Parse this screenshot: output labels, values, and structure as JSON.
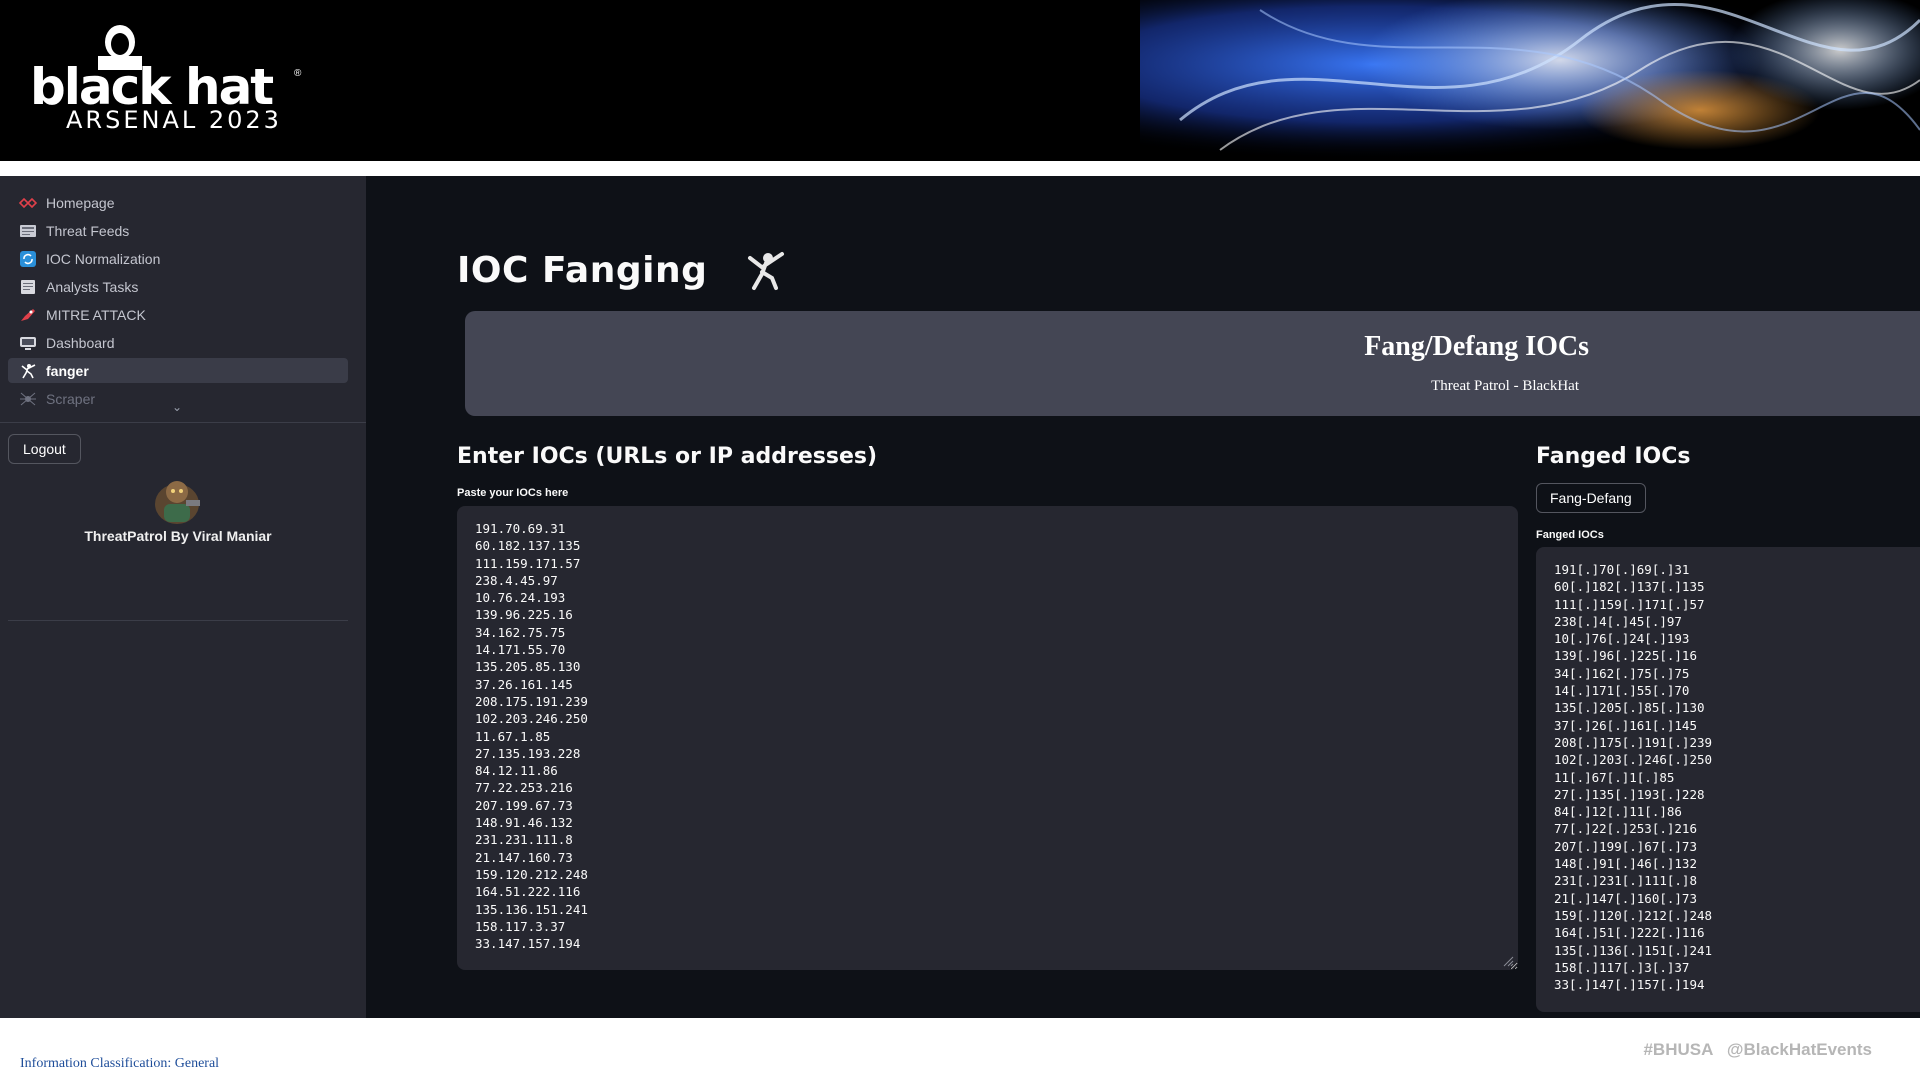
{
  "banner": {
    "logo_word": "black hat",
    "logo_reg": "®",
    "logo_event": "ARSENAL 2023"
  },
  "sidebar": {
    "items": [
      {
        "label": "Homepage",
        "icon": "radar-icon"
      },
      {
        "label": "Threat Feeds",
        "icon": "newspaper-icon"
      },
      {
        "label": "IOC Normalization",
        "icon": "refresh-icon"
      },
      {
        "label": "Analysts Tasks",
        "icon": "notepad-icon"
      },
      {
        "label": "MITRE ATTACK",
        "icon": "rocket-icon"
      },
      {
        "label": "Dashboard",
        "icon": "monitor-icon"
      },
      {
        "label": "fanger",
        "icon": "fencer-icon"
      },
      {
        "label": "Scraper",
        "icon": "spider-icon"
      }
    ],
    "active_item": "fanger",
    "logout_label": "Logout",
    "credit": "ThreatPatrol By Viral Maniar"
  },
  "main": {
    "title": "IOC Fanging",
    "hero_title": "Fang/Defang IOCs",
    "hero_subtitle": "Threat Patrol - BlackHat",
    "left_heading": "Enter IOCs (URLs or IP addresses)",
    "input_label": "Paste your IOCs here",
    "input_value": "191.70.69.31\n60.182.137.135\n111.159.171.57\n238.4.45.97\n10.76.24.193\n139.96.225.16\n34.162.75.75\n14.171.55.70\n135.205.85.130\n37.26.161.145\n208.175.191.239\n102.203.246.250\n11.67.1.85\n27.135.193.228\n84.12.11.86\n77.22.253.216\n207.199.67.73\n148.91.46.132\n231.231.111.8\n21.147.160.73\n159.120.212.248\n164.51.222.116\n135.136.151.241\n158.117.3.37\n33.147.157.194",
    "right_heading": "Fanged IOCs",
    "fang_button": "Fang-Defang",
    "output_label": "Fanged IOCs",
    "output_lines": [
      "191[.]70[.]69[.]31",
      "60[.]182[.]137[.]135",
      "111[.]159[.]171[.]57",
      "238[.]4[.]45[.]97",
      "10[.]76[.]24[.]193",
      "139[.]96[.]225[.]16",
      "34[.]162[.]75[.]75",
      "14[.]171[.]55[.]70",
      "135[.]205[.]85[.]130",
      "37[.]26[.]161[.]145",
      "208[.]175[.]191[.]239",
      "102[.]203[.]246[.]250",
      "11[.]67[.]1[.]85",
      "27[.]135[.]193[.]228",
      "84[.]12[.]11[.]86",
      "77[.]22[.]253[.]216",
      "207[.]199[.]67[.]73",
      "148[.]91[.]46[.]132",
      "231[.]231[.]111[.]8",
      "21[.]147[.]160[.]73",
      "159[.]120[.]212[.]248",
      "164[.]51[.]222[.]116",
      "135[.]136[.]151[.]241",
      "158[.]117[.]3[.]37",
      "33[.]147[.]157[.]194"
    ]
  },
  "footer": {
    "classification": "Information Classification: General",
    "hashtags": "#BHUSA   @BlackHatEvents"
  },
  "colors": {
    "app_bg": "#0e1117",
    "sidebar_bg": "#262730",
    "panel_bg": "#262730",
    "hero_bg": "#444654",
    "footer_link": "#1f4e9a"
  }
}
